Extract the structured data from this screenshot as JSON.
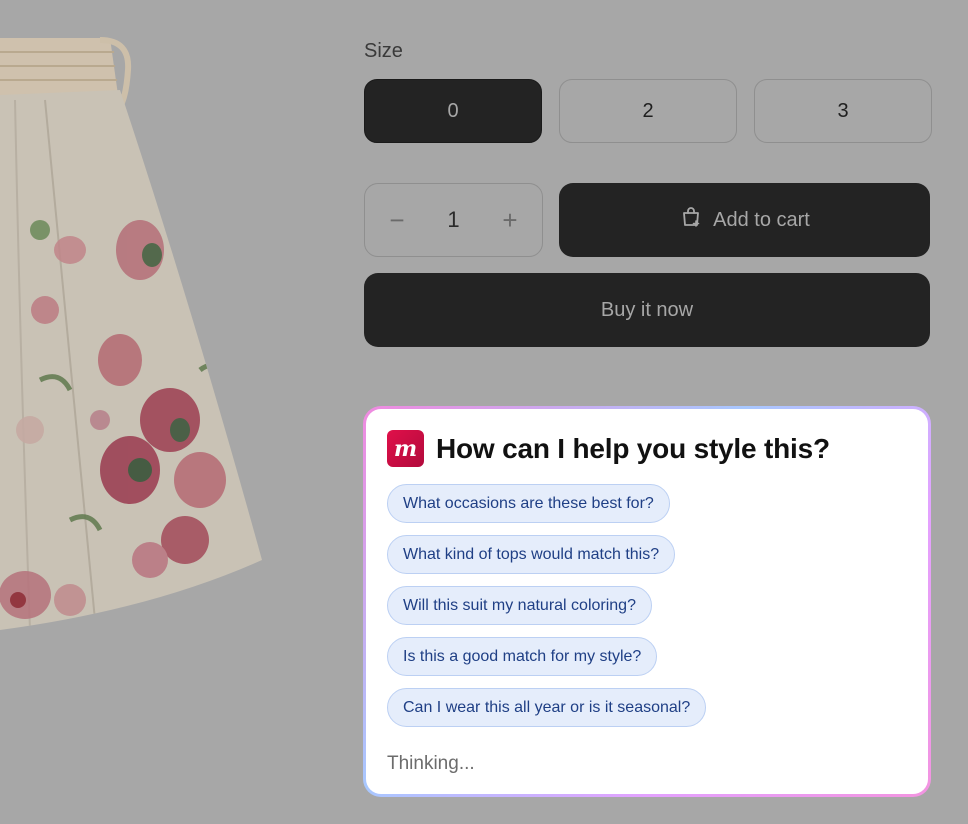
{
  "size": {
    "label": "Size",
    "options": [
      "0",
      "2",
      "3"
    ],
    "selected": "0"
  },
  "quantity": {
    "decrease": "−",
    "value": "1",
    "increase": "+"
  },
  "actions": {
    "add_to_cart": "Add to cart",
    "buy_now": "Buy it now"
  },
  "assistant": {
    "logo_letter": "m",
    "title": "How can I help you style this?",
    "suggestions": [
      "What occasions are these best for?",
      "What kind of tops would match this?",
      "Will this suit my natural coloring?",
      "Is this a good match for my style?",
      "Can I wear this all year or is it seasonal?"
    ],
    "status": "Thinking..."
  },
  "icons": {
    "cart": "shopping-bag-plus-icon"
  },
  "colors": {
    "overlay": "#a7a7a7",
    "button_dark": "#232323",
    "chip_bg": "#e5edfb",
    "chip_text": "#1f3f85",
    "logo": "#d80f46"
  }
}
